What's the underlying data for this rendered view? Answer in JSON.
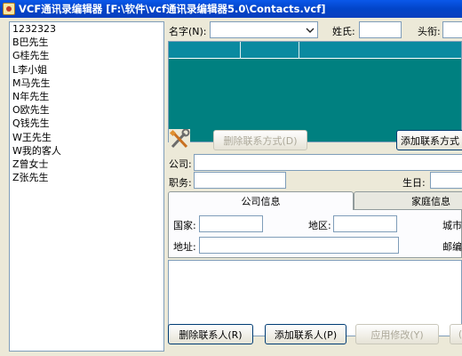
{
  "window": {
    "title": "VCF通讯录编辑器 [F:\\软件\\vcf通讯录编辑器5.0\\Contacts.vcf]"
  },
  "contacts": [
    "1232323",
    "B巴先生",
    "G桂先生",
    "L李小姐",
    "M马先生",
    "N年先生",
    "O欧先生",
    "Q钱先生",
    "W王先生",
    "W我的客人",
    "Z曾女士",
    "Z张先生"
  ],
  "form": {
    "name_label": "名字(N):",
    "surname_label": "姓氏:",
    "title_label": "头衔:",
    "delete_contact_method": "删除联系方式(D)",
    "add_contact_method": "添加联系方式",
    "company_label": "公司:",
    "position_label": "职务:",
    "birthday_label": "生日:"
  },
  "tabs": {
    "company_info": "公司信息",
    "family_info": "家庭信息"
  },
  "company_tab": {
    "country_label": "国家:",
    "region_label": "地区:",
    "city_label": "城市",
    "address_label": "地址:",
    "postcode_label": "邮编"
  },
  "buttons": {
    "delete_contact": "删除联系人(R)",
    "add_contact": "添加联系人(P)",
    "apply_changes": "应用修改(Y)",
    "partial_button": "("
  },
  "colors": {
    "titlebar": "#0a58ea",
    "grid_background": "#008080",
    "window_face": "#ece9d8"
  },
  "icons": {
    "app": "address-book-icon",
    "tools": "tools-icon",
    "dropdown": "chevron-down-icon"
  }
}
